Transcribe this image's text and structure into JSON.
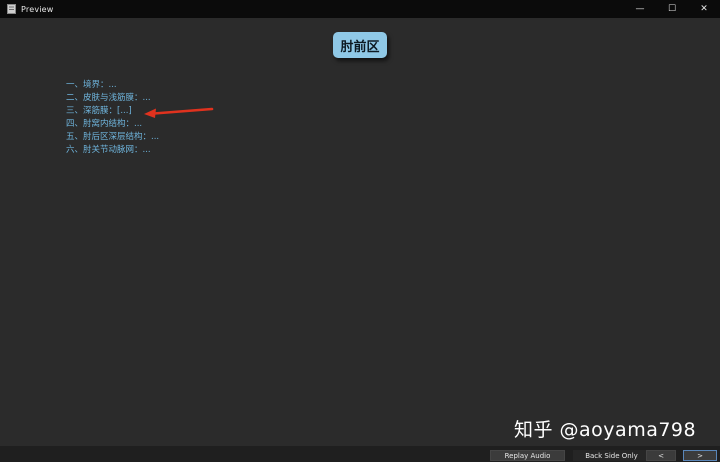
{
  "window": {
    "title": "Preview",
    "controls": {
      "minimize": "—",
      "maximize": "☐",
      "close": "✕"
    }
  },
  "card": {
    "heading": "肘前区",
    "outline": [
      "一、境界：...",
      "二、皮肤与浅筋膜：...",
      "三、深筋膜：[...]",
      "四、肘窝内结构：...",
      "五、肘后区深层结构：...",
      "六、肘关节动脉网：..."
    ],
    "highlight_color": "#e0321e",
    "text_color": "#6fb5dd",
    "heading_bg": "#8fc8e6"
  },
  "watermark": "知乎 @aoyama798",
  "bottom_bar": {
    "replay_audio": "Replay Audio",
    "back_side_only": "Back Side Only",
    "prev": "<",
    "next": ">"
  }
}
